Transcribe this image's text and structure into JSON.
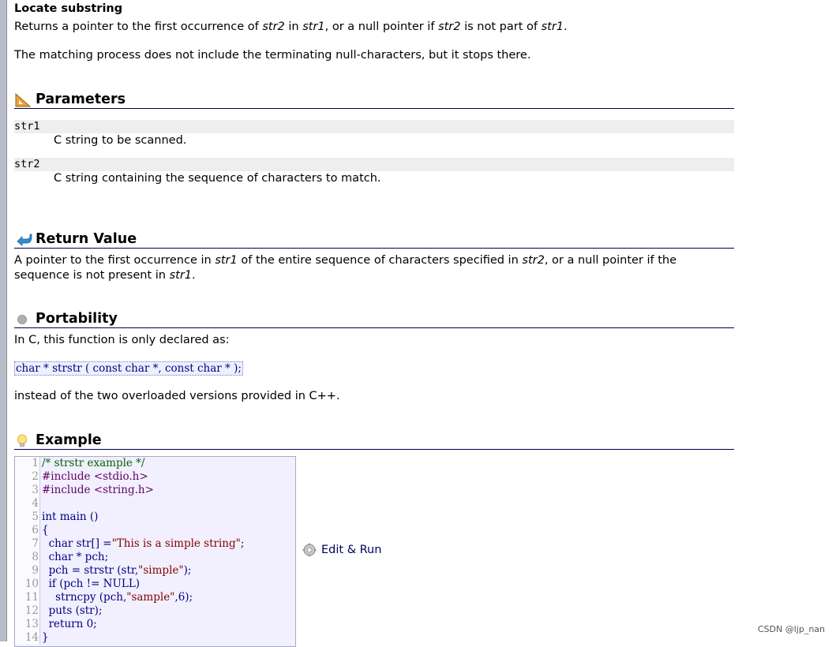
{
  "title": "Locate substring",
  "intro": {
    "p1": [
      "Returns a pointer to the first occurrence of ",
      "str2",
      " in ",
      "str1",
      ", or a null pointer if ",
      "str2",
      " is not part of ",
      "str1",
      "."
    ],
    "p2": "The matching process does not include the terminating null-characters, but it stops there."
  },
  "params": {
    "heading": "Parameters",
    "items": [
      {
        "name": "str1",
        "desc": "C string to be scanned."
      },
      {
        "name": "str2",
        "desc": "C string containing the sequence of characters to match."
      }
    ]
  },
  "return_value": {
    "heading": "Return Value",
    "text": [
      "A pointer to the first occurrence in ",
      "str1",
      " of the entire sequence of characters specified in ",
      "str2",
      ", or a null pointer if the sequence is not present in ",
      "str1",
      "."
    ]
  },
  "portability": {
    "heading": "Portability",
    "text1": "In C, this function is only declared as:",
    "declaration": "char * strstr ( const char *, const char * );",
    "text2": "instead of the two overloaded versions provided in C++."
  },
  "example": {
    "heading": "Example",
    "run_label": "Edit & Run",
    "lines": [
      {
        "n": "1",
        "t": "/* strstr example */",
        "k": "com"
      },
      {
        "n": "2",
        "t": "#include <stdio.h>",
        "k": "pre"
      },
      {
        "n": "3",
        "t": "#include <string.h>",
        "k": "pre"
      },
      {
        "n": "4",
        "t": "",
        "k": ""
      },
      {
        "n": "5",
        "t": "int main ()",
        "k": ""
      },
      {
        "n": "6",
        "t": "{",
        "k": ""
      },
      {
        "n": "7",
        "t": "  char str[] =",
        "s": "\"This is a simple string\"",
        "e": ";",
        "k": "mix"
      },
      {
        "n": "8",
        "t": "  char * pch;",
        "k": ""
      },
      {
        "n": "9",
        "t": "  pch = strstr (str,",
        "s": "\"simple\"",
        "e": ");",
        "k": "mix"
      },
      {
        "n": "10",
        "t": "  if (pch != NULL)",
        "k": ""
      },
      {
        "n": "11",
        "t": "    strncpy (pch,",
        "s": "\"sample\"",
        "e": ",6);",
        "k": "mix"
      },
      {
        "n": "12",
        "t": "  puts (str);",
        "k": ""
      },
      {
        "n": "13",
        "t": "  return 0;",
        "k": ""
      },
      {
        "n": "14",
        "t": "}",
        "k": ""
      }
    ]
  },
  "watermark": "CSDN @ljp_nan",
  "icons": {
    "parameters": "ruler-triangle-icon",
    "return_value": "return-arrow-icon",
    "portability": "gray-dot-icon",
    "example": "lightbulb-icon",
    "run": "gear-icon"
  }
}
